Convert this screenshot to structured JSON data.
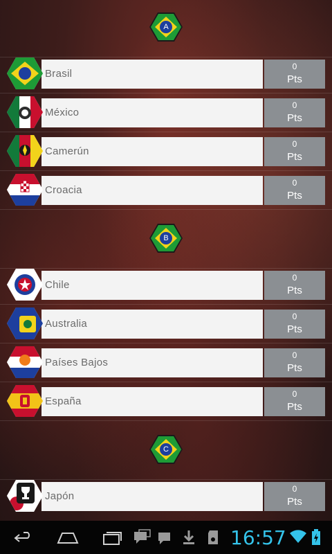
{
  "groups": [
    {
      "letter": "A",
      "teams": [
        {
          "name": "Brasil",
          "points": "0",
          "unit": "Pts"
        },
        {
          "name": "México",
          "points": "0",
          "unit": "Pts"
        },
        {
          "name": "Camerún",
          "points": "0",
          "unit": "Pts"
        },
        {
          "name": "Croacia",
          "points": "0",
          "unit": "Pts"
        }
      ]
    },
    {
      "letter": "B",
      "teams": [
        {
          "name": "Chile",
          "points": "0",
          "unit": "Pts"
        },
        {
          "name": "Australia",
          "points": "0",
          "unit": "Pts"
        },
        {
          "name": "Países Bajos",
          "points": "0",
          "unit": "Pts"
        },
        {
          "name": "España",
          "points": "0",
          "unit": "Pts"
        }
      ]
    },
    {
      "letter": "C",
      "teams": [
        {
          "name": "Japón",
          "points": "0",
          "unit": "Pts"
        }
      ]
    }
  ],
  "status_bar": {
    "time": "16:57"
  },
  "colors": {
    "accent": "#34c3ea",
    "badge_green": "#1e9b36",
    "badge_yellow": "#f2d31b",
    "badge_blue": "#1d3f9e",
    "points_bg": "#8b8f93"
  },
  "icons": {
    "nav": [
      "back-icon",
      "home-icon",
      "recent-apps-icon"
    ],
    "status": [
      "chat-icon",
      "message-icon",
      "download-icon",
      "sd-card-icon",
      "wifi-icon",
      "battery-icon"
    ]
  }
}
